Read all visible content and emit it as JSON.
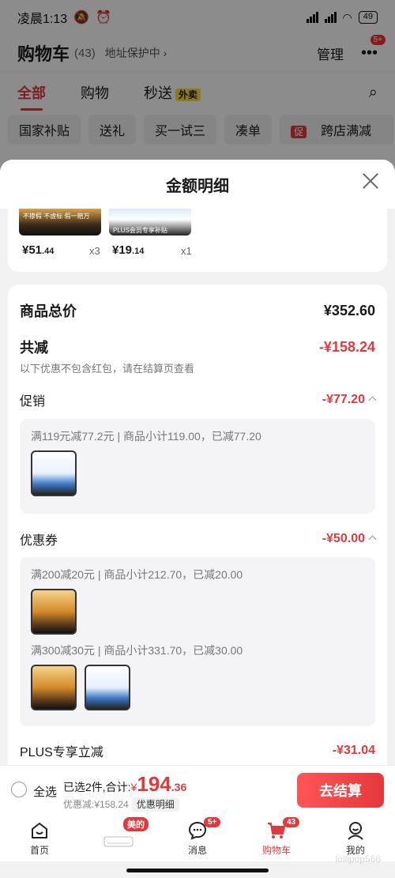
{
  "status_bar": {
    "time": "凌晨1:13",
    "battery": "49"
  },
  "background": {
    "title": "购物车",
    "count": "(43)",
    "address": "地址保护中 ›",
    "manage": "管理",
    "more_badge": "5+",
    "tabs": [
      {
        "label": "全部"
      },
      {
        "label": "购物"
      },
      {
        "label": "秒送",
        "tag": "外卖"
      }
    ],
    "chips": [
      "国家补贴",
      "送礼",
      "买一试三",
      "凑单",
      "跨店满减"
    ],
    "chip_cu": "促"
  },
  "sheet": {
    "title": "金额明细",
    "products": [
      {
        "price_int": "¥51",
        "price_dec": ".44",
        "qty": "x3",
        "caption": "不掺假 不虚标 假一赔万"
      },
      {
        "price_int": "¥19",
        "price_dec": ".14",
        "qty": "x1",
        "caption": "PLUS会员专享补贴"
      }
    ],
    "total_label": "商品总价",
    "total_value": "¥352.60",
    "reduce_label": "共减",
    "reduce_value": "-¥158.24",
    "note": "以下优惠不包含红包，请在结算页查看",
    "promo_label": "促销",
    "promo_value": "-¥77.20",
    "promo_line": "满119元减77.2元 | 商品小计119.00，已减77.20",
    "coupon_label": "优惠券",
    "coupon_value": "-¥50.00",
    "coupon_line1": "满200减20元 | 商品小计212.70，已减20.00",
    "coupon_line2": "满300减30元 | 商品小计331.70，已减30.00",
    "plus_label": "PLUS专享立减",
    "plus_value": "-¥31.04"
  },
  "checkout": {
    "select_all": "全选",
    "summary_prefix": "已选2件,合计:",
    "yen": "¥",
    "amount": "194",
    "decimal": ".36",
    "discount_text": "优惠减:¥158.24",
    "detail_btn": "优惠明细",
    "pay_label": "去结算"
  },
  "tabbar": [
    {
      "label": "首页",
      "icon": "home-icon"
    },
    {
      "label": "",
      "icon": "aircon-promo-icon",
      "badge": "美的"
    },
    {
      "label": "消息",
      "icon": "message-icon",
      "badge": "5+"
    },
    {
      "label": "购物车",
      "icon": "cart-icon",
      "badge": "43"
    },
    {
      "label": "我的",
      "icon": "profile-icon"
    }
  ],
  "watermark": "lollipop566",
  "colors": {
    "accent": "#e4393c",
    "background": "#f2f2f2"
  }
}
